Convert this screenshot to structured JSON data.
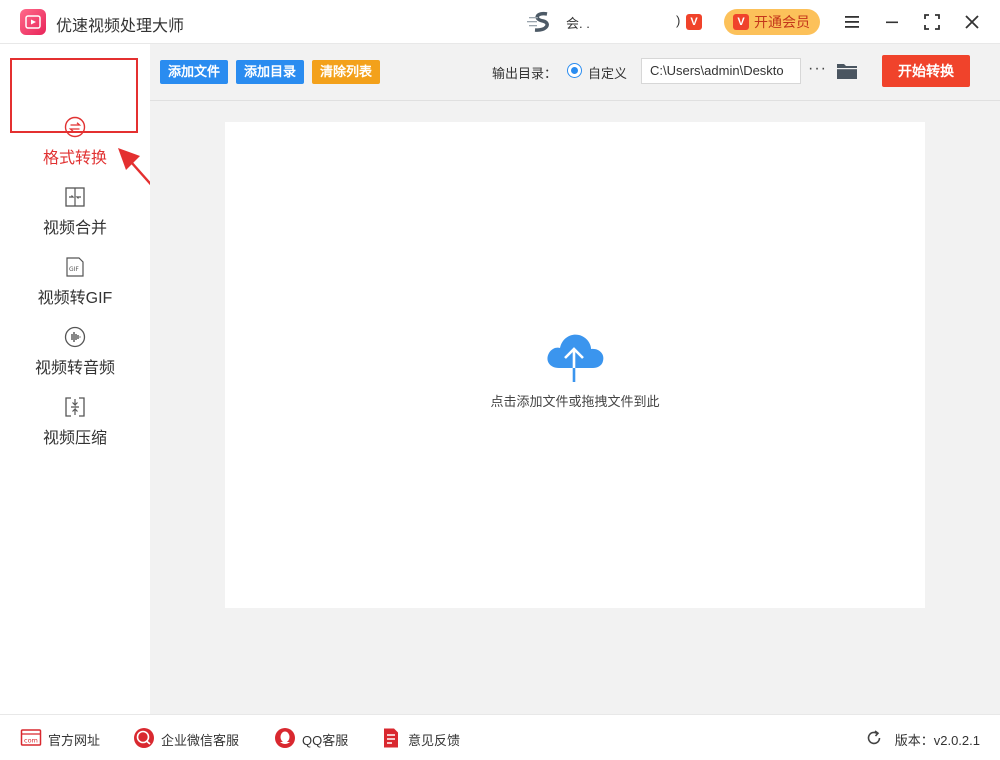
{
  "app": {
    "title": "优速视频处理大师"
  },
  "user": {
    "name": "会.  .",
    "paren": ")",
    "vip_badge": "V"
  },
  "header": {
    "vip_button_label": "开通会员",
    "vip_icon": "V"
  },
  "sidebar": {
    "items": [
      {
        "label": "格式转换",
        "icon": "convert-icon",
        "active": true
      },
      {
        "label": "视频合并",
        "icon": "merge-icon"
      },
      {
        "label": "视频转GIF",
        "icon": "gif-icon",
        "icon_text": "GIF"
      },
      {
        "label": "视频转音频",
        "icon": "audio-icon"
      },
      {
        "label": "视频压缩",
        "icon": "compress-icon"
      }
    ]
  },
  "toolbar": {
    "add_file": "添加文件",
    "add_folder": "添加目录",
    "clear_list": "清除列表",
    "output_label": "输出目录：",
    "custom_label": "自定义",
    "path_value": "C:\\Users\\admin\\Deskto",
    "more": "···",
    "start": "开始转换"
  },
  "main": {
    "drop_hint": "点击添加文件或拖拽文件到此"
  },
  "footer": {
    "items": [
      {
        "label": "官方网址",
        "icon": "website-icon",
        "icon_text": "com"
      },
      {
        "label": "企业微信客服",
        "icon": "wechat-icon"
      },
      {
        "label": "QQ客服",
        "icon": "qq-icon"
      },
      {
        "label": "意见反馈",
        "icon": "feedback-icon"
      }
    ],
    "version": "版本：v2.0.2.1"
  },
  "colors": {
    "accent_blue": "#2a8cf0",
    "accent_red": "#f0432b",
    "accent_orange": "#f3a11b",
    "vip_yellow": "#fcc15a",
    "highlight_red": "#e43030"
  }
}
